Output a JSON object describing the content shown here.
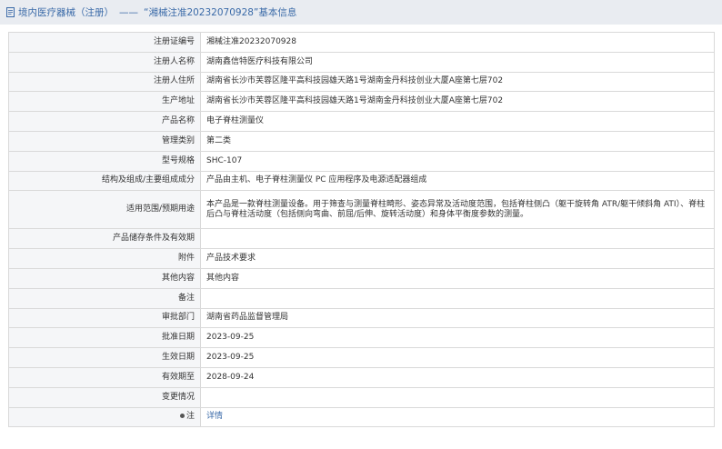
{
  "header": {
    "breadcrumb_main": "境内医疗器械（注册）",
    "separator": "——",
    "detail_title": "“湘械注准20232070928”基本信息"
  },
  "rows": [
    {
      "label": "注册证编号",
      "value": "湘械注准20232070928"
    },
    {
      "label": "注册人名称",
      "value": "湖南鑫信特医疗科技有限公司"
    },
    {
      "label": "注册人住所",
      "value": "湖南省长沙市芙蓉区隆平高科技园雄天路1号湖南金丹科技创业大厦A座第七层702"
    },
    {
      "label": "生产地址",
      "value": "湖南省长沙市芙蓉区隆平高科技园雄天路1号湖南金丹科技创业大厦A座第七层702"
    },
    {
      "label": "产品名称",
      "value": "电子脊柱测量仪"
    },
    {
      "label": "管理类别",
      "value": "第二类"
    },
    {
      "label": "型号规格",
      "value": "SHC-107"
    },
    {
      "label": "结构及组成/主要组成成分",
      "value": "产品由主机、电子脊柱测量仪 PC 应用程序及电源适配器组成"
    },
    {
      "label": "适用范围/预期用途",
      "value": "本产品是一款脊柱测量设备。用于筛查与测量脊柱畸形、姿态异常及活动度范围，包括脊柱侧凸（躯干旋转角 ATR/躯干倾斜角 ATI）、脊柱后凸与脊柱活动度（包括侧向弯曲、前屈/后伸、旋转活动度）和身体平衡度参数的测量。"
    },
    {
      "label": "产品储存条件及有效期",
      "value": ""
    },
    {
      "label": "附件",
      "value": "产品技术要求"
    },
    {
      "label": "其他内容",
      "value": "其他内容"
    },
    {
      "label": "备注",
      "value": ""
    },
    {
      "label": "审批部门",
      "value": "湖南省药品监督管理局"
    },
    {
      "label": "批准日期",
      "value": "2023-09-25"
    },
    {
      "label": "生效日期",
      "value": "2023-09-25"
    },
    {
      "label": "有效期至",
      "value": "2028-09-24"
    },
    {
      "label": "变更情况",
      "value": ""
    },
    {
      "label": "注",
      "value": "详情"
    }
  ]
}
